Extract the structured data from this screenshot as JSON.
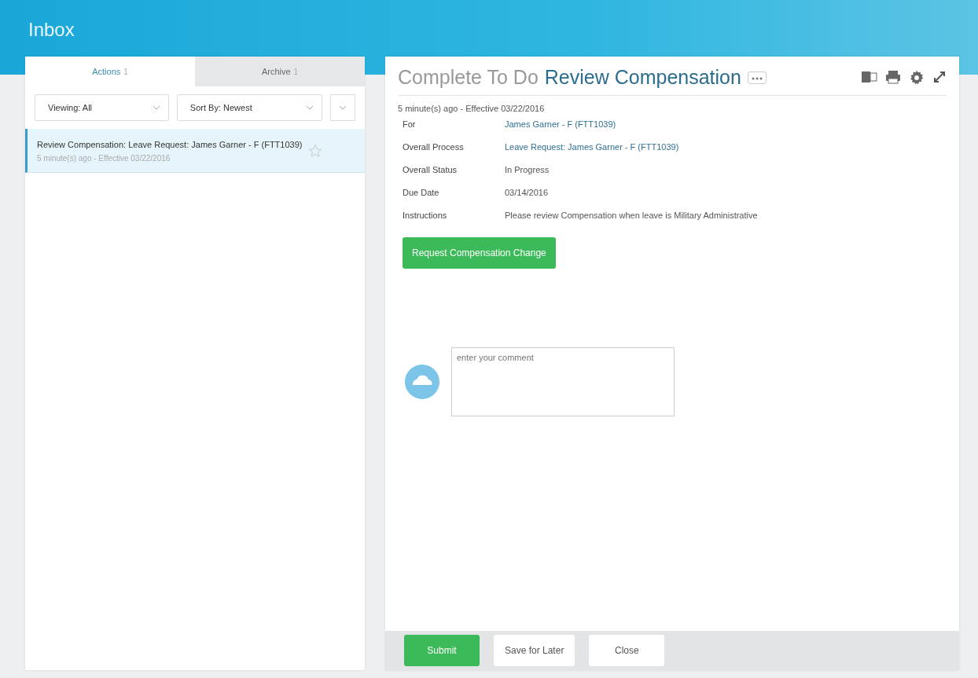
{
  "header": {
    "title": "Inbox"
  },
  "tabs": [
    {
      "label": "Actions",
      "count": "1",
      "selected": true
    },
    {
      "label": "Archive",
      "count": "1",
      "selected": false
    }
  ],
  "filters": [
    {
      "label": "Viewing: All"
    },
    {
      "label": "Sort By: Newest"
    }
  ],
  "items": [
    {
      "title": "Review Compensation: Leave Request: James Garner - F (FTT1039)",
      "meta": "5 minute(s) ago - Effective 03/22/2016",
      "selected": true,
      "starred": false
    }
  ],
  "detail": {
    "prefix": "Complete To Do",
    "title": "Review Compensation",
    "meta": "5 minute(s) ago - Effective 03/22/2016",
    "fields": [
      {
        "label": "For",
        "value": "James Garner - F (FTT1039)",
        "kind": "link"
      },
      {
        "label": "Overall Process",
        "value": "Leave Request: James Garner - F (FTT1039)",
        "kind": "link"
      },
      {
        "label": "Overall Status",
        "value": "In Progress",
        "kind": "text"
      },
      {
        "label": "Due Date",
        "value": "03/14/2016",
        "kind": "text"
      },
      {
        "label": "Instructions",
        "value": "Please review Compensation when leave is Military Administrative",
        "kind": "text"
      }
    ],
    "action": "Request Compensation Change",
    "comment": {
      "placeholder": "enter your comment"
    }
  },
  "footer": {
    "buttons": [
      {
        "label": "Submit",
        "kind": "primary"
      },
      {
        "label": "Save for Later",
        "kind": "secondary"
      },
      {
        "label": "Close",
        "kind": "secondary"
      }
    ]
  }
}
